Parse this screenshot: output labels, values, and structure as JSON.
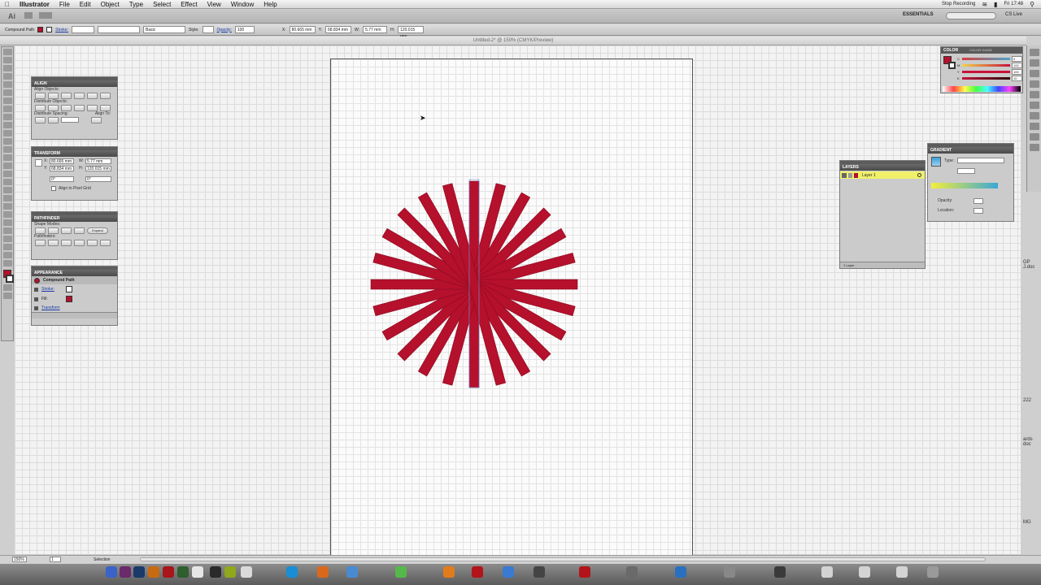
{
  "menubar": {
    "apple": "",
    "items": [
      "Illustrator",
      "File",
      "Edit",
      "Object",
      "Type",
      "Select",
      "Effect",
      "View",
      "Window",
      "Help"
    ],
    "recording": "Stop Recording",
    "clock": "Fri 17:48"
  },
  "appbar": {
    "app_icon": "Ai",
    "workspace": "ESSENTIALS",
    "cs_live": "CS Live"
  },
  "control_bar": {
    "selection_label": "Compound Path",
    "stroke_label": "Stroke:",
    "brush_label": "Basic",
    "style_label": "Style:",
    "opacity_label": "Opacity:",
    "opacity_value": "100",
    "x_label": "X:",
    "x_value": "80.665 mm",
    "y_label": "Y:",
    "y_value": "68.834 mm",
    "w_label": "W:",
    "w_value": "5.77 mm",
    "h_label": "H:",
    "h_value": "120.015 mm"
  },
  "document": {
    "title": "Untitled-2* @ 150% (CMYK/Preview)",
    "zoom": "150%",
    "status": "Selection",
    "page": "1"
  },
  "panels": {
    "align": {
      "title": "ALIGN",
      "align_objects": "Align Objects:",
      "distribute_objects": "Distribute Objects:",
      "distribute_spacing": "Distribute Spacing:",
      "align_to": "Align To:"
    },
    "transform": {
      "title": "TRANSFORM",
      "x_label": "X:",
      "x_value": "80.665 mm",
      "y_label": "Y:",
      "y_value": "68.834 mm",
      "w_label": "W:",
      "w_value": "5.77 mm",
      "h_label": "H:",
      "h_value": "120.015 mm",
      "rotate_value": "0°",
      "shear_value": "0°",
      "pixel_grid": "Align to Pixel Grid"
    },
    "pathfinder": {
      "title": "PATHFINDER",
      "shape_modes": "Shape Modes:",
      "pathfinders": "Pathfinders:",
      "expand": "Expand"
    },
    "appearance": {
      "title": "APPEARANCE",
      "object": "Compound Path",
      "stroke": "Stroke:",
      "fill": "Fill:",
      "transform": "Transform"
    },
    "layers": {
      "title": "LAYERS",
      "layer_name": "Layer 1",
      "count": "1 Layer"
    },
    "color": {
      "title": "COLOR",
      "guide_tab": "COLOR GUIDE",
      "c_label": "C",
      "c_value": "0",
      "m_label": "M",
      "m_value": "100",
      "y_label": "Y",
      "y_value": "100",
      "k_label": "K",
      "k_value": "10"
    },
    "gradient": {
      "title": "GRADIENT",
      "type_label": "Type:",
      "opacity_label": "Opacity:",
      "location_label": "Location:"
    }
  },
  "right_edge_text": [
    "GP",
    "J.doc",
    "222",
    "ards",
    "doc",
    "MG"
  ],
  "colors": {
    "artwork_fill": "#b5102c",
    "artwork_stroke": "#8a0a1f",
    "layer_highlight": "#f0f06a",
    "panel_title": "#555555",
    "link": "#1a3ba8"
  },
  "icons": [
    "apple-icon",
    "wifi-icon",
    "battery-icon",
    "spotlight-icon",
    "selection-tool-icon",
    "direct-select-icon",
    "pen-icon",
    "type-icon",
    "zoom-icon",
    "hand-icon",
    "fill-swatch-icon",
    "stroke-swatch-icon"
  ]
}
